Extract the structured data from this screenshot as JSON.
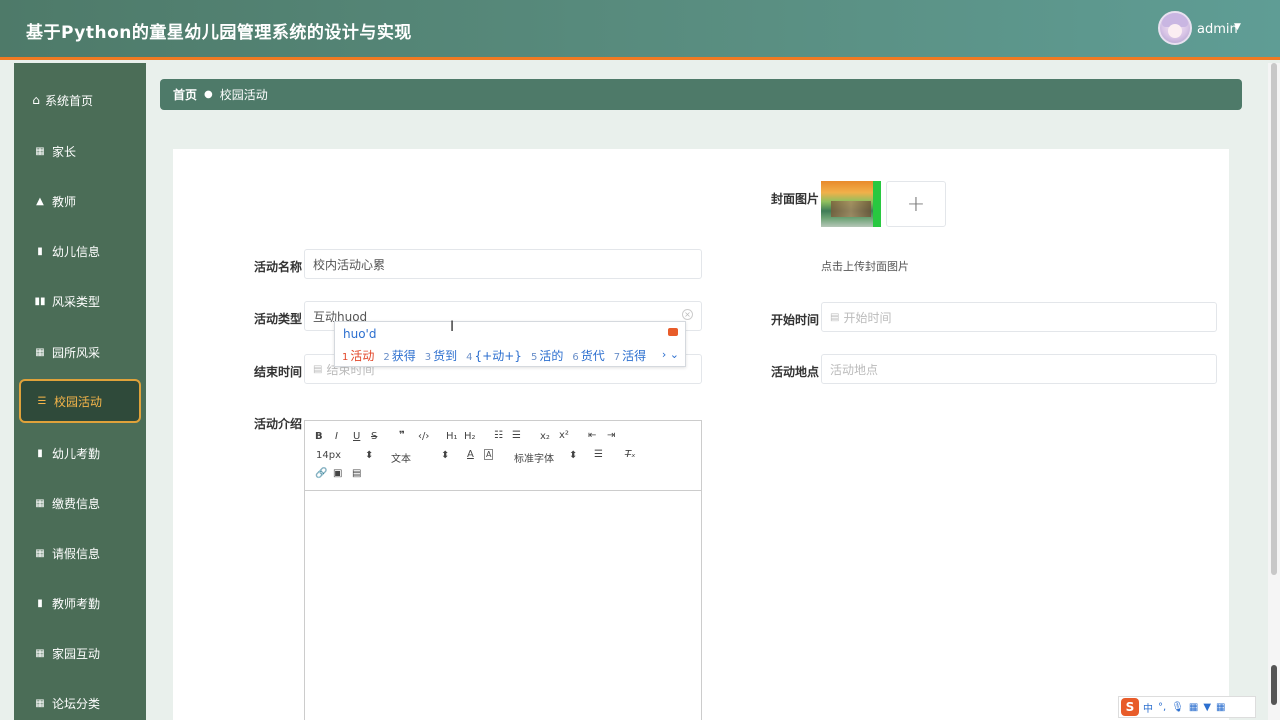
{
  "app": {
    "title": "基于Python的童星幼儿园管理系统的设计与实现",
    "username": "admin"
  },
  "sidebar": {
    "items": [
      {
        "label": "系统首页",
        "icon": "home-icon"
      },
      {
        "label": "家长",
        "icon": "grid-icon"
      },
      {
        "label": "教师",
        "icon": "thumb-icon"
      },
      {
        "label": "幼儿信息",
        "icon": "clipboard-icon"
      },
      {
        "label": "风采类型",
        "icon": "bar-chart-icon"
      },
      {
        "label": "园所风采",
        "icon": "table-icon"
      },
      {
        "label": "校园活动",
        "icon": "list-icon",
        "active": true
      },
      {
        "label": "幼儿考勤",
        "icon": "book-icon"
      },
      {
        "label": "缴费信息",
        "icon": "grid-icon"
      },
      {
        "label": "请假信息",
        "icon": "grid-icon"
      },
      {
        "label": "教师考勤",
        "icon": "book-icon"
      },
      {
        "label": "家园互动",
        "icon": "grid-icon"
      },
      {
        "label": "论坛分类",
        "icon": "grid-icon"
      }
    ]
  },
  "breadcrumb": {
    "home": "首页",
    "current": "校园活动"
  },
  "form": {
    "cover_label": "封面图片",
    "cover_hint": "点击上传封面图片",
    "name_label": "活动名称",
    "name_value": "校内活动心累",
    "type_label": "活动类型",
    "type_value": "互动huod",
    "start_label": "开始时间",
    "start_placeholder": "开始时间",
    "end_label": "结束时间",
    "end_placeholder": "结束时间",
    "location_label": "活动地点",
    "location_placeholder": "活动地点",
    "intro_label": "活动介绍"
  },
  "editor": {
    "font_size": "14px",
    "text_style": "文本",
    "font_family": "标准字体"
  },
  "ime": {
    "composition": "huo'd",
    "candidates": [
      {
        "n": "1",
        "text": "活动"
      },
      {
        "n": "2",
        "text": "获得"
      },
      {
        "n": "3",
        "text": "货到"
      },
      {
        "n": "4",
        "text": "{+动+}"
      },
      {
        "n": "5",
        "text": "活的"
      },
      {
        "n": "6",
        "text": "货代"
      },
      {
        "n": "7",
        "text": "活得"
      }
    ]
  },
  "imebar": {
    "lang": "中"
  },
  "colors": {
    "header": "#4e7a69",
    "accent": "#f07a22",
    "sidebar": "#4b6d57",
    "active": "#f5b54a"
  }
}
